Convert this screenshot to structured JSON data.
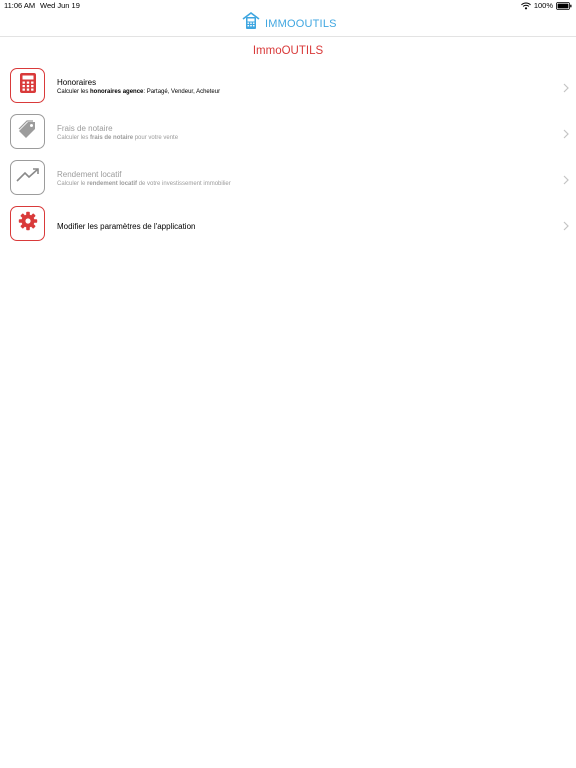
{
  "status_bar": {
    "time": "11:06 AM",
    "date": "Wed Jun 19",
    "battery": "100%"
  },
  "header": {
    "app_name": "IMMOOUTILS"
  },
  "page": {
    "title": "ImmoOUTILS"
  },
  "menu": {
    "items": [
      {
        "icon": "calculator-icon",
        "title": "Honoraires",
        "sub_prefix": "Calculer les ",
        "sub_bold": "honoraires agence",
        "sub_suffix": ": Partagé, Vendeur, Acheteur",
        "enabled": true
      },
      {
        "icon": "price-tag-icon",
        "title": "Frais de notaire",
        "sub_prefix": "Calculer les ",
        "sub_bold": "frais de notaire",
        "sub_suffix": " pour votre vente",
        "enabled": false
      },
      {
        "icon": "trend-up-icon",
        "title": "Rendement locatif",
        "sub_prefix": "Calculer le ",
        "sub_bold": "rendement locatif",
        "sub_suffix": " de votre investissement immobilier",
        "enabled": false
      },
      {
        "icon": "gear-icon",
        "title": "Modifier les paramètres de l'application",
        "enabled": true
      }
    ]
  },
  "colors": {
    "accent": "#d93a3a",
    "brand": "#3fa6e0",
    "disabled": "#9c9c9c"
  }
}
